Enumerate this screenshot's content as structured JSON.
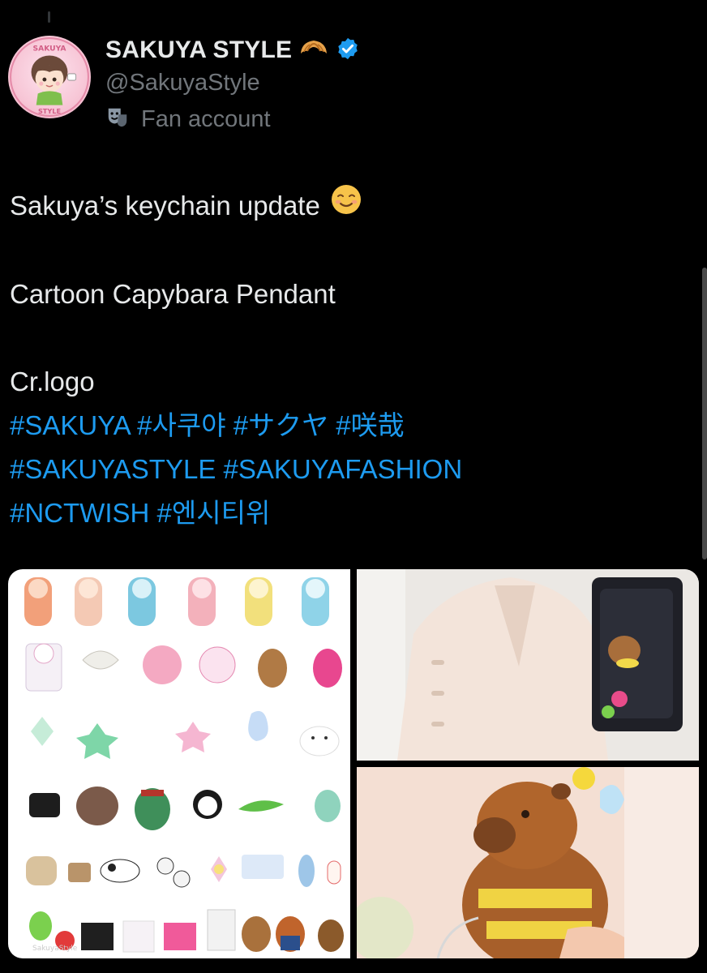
{
  "author": {
    "display_name": "SAKUYA STYLE",
    "handle": "@SakuyaStyle",
    "label": "Fan account",
    "avatar_text": "SAKUYA STYLE",
    "icons": {
      "name_emoji": "croissant-icon",
      "verified": "verified-badge-icon",
      "label_icon": "theater-masks-icon"
    }
  },
  "tweet": {
    "line1": "Sakuya’s keychain update",
    "line1_emoji": "smiling-face-icon",
    "line2": "Cartoon Capybara Pendant",
    "line3": "Cr.logo",
    "hashtags": [
      [
        "#SAKUYA",
        "#사쿠야",
        "#サクヤ",
        "#咲哉"
      ],
      [
        "#SAKUYASTYLE",
        "#SAKUYAFASHION"
      ],
      [
        "#NCTWISH",
        "#엔시티위"
      ]
    ]
  },
  "media": {
    "tiles": [
      {
        "name": "keychain-catalog-image",
        "watermark": "SakuyaStyle"
      },
      {
        "name": "coat-with-keychain-photo"
      },
      {
        "name": "capybara-plush-photo"
      }
    ]
  },
  "colors": {
    "background": "#000000",
    "text": "#e7e9ea",
    "secondary": "#71767b",
    "link": "#1d9bf0",
    "verified": "#1d9bf0"
  }
}
